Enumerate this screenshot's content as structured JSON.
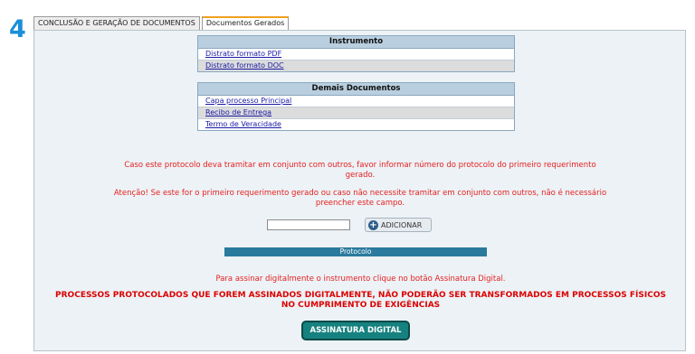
{
  "step_number": "4",
  "tabs": [
    {
      "label": "CONCLUSÃO E GERAÇÃO DE DOCUMENTOS",
      "active": false
    },
    {
      "label": "Documentos Gerados",
      "active": true
    }
  ],
  "instrumento": {
    "header": "Instrumento",
    "rows": [
      "Distrato formato PDF",
      "Distrato formato DOC"
    ]
  },
  "demais": {
    "header": "Demais Documentos",
    "rows": [
      "Capa processo Principal",
      "Recibo de Entrega",
      "Termo de Veracidade"
    ]
  },
  "messages": {
    "tramitar_line1": "Caso este protocolo deva tramitar em conjunto com outros, favor informar número do protocolo do primeiro requerimento",
    "tramitar_line2": "gerado.",
    "atencao_line1": "Atenção! Se este for o primeiro requerimento gerado ou caso não necessite tramitar em conjunto com outros, não é necessário",
    "atencao_line2": "preencher este campo.",
    "assinar": "Para assinar digitalmente o instrumento clique no botão Assinatura Digital.",
    "warning_line1": "PROCESSOS PROTOCOLADOS QUE FOREM ASSINADOS DIGITALMENTE, NÃO PODERÃO SER TRANSFORMADOS EM PROCESSOS FÍSICOS",
    "warning_line2": "NO CUMPRIMENTO DE EXIGÊNCIAS"
  },
  "protocol_input": {
    "value": "",
    "placeholder": ""
  },
  "add_button": {
    "label": "ADICIONAR",
    "icon": "plus-circle-icon"
  },
  "protocolo_bar": {
    "label": "Protocolo"
  },
  "sign_button": {
    "label": "ASSINATURA DIGITAL"
  },
  "colors": {
    "accent": "#1a8fd8",
    "warning": "#e62020",
    "bar": "#2a7a9e",
    "button": "#16827f"
  }
}
